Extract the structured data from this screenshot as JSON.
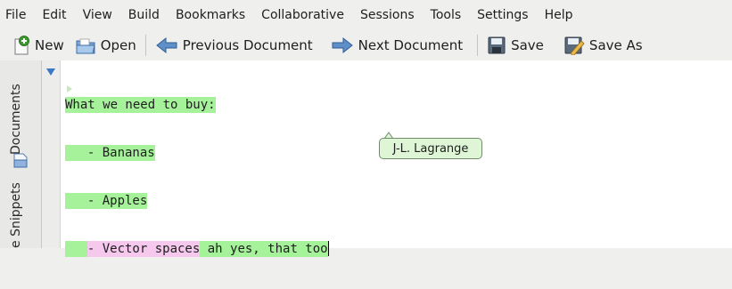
{
  "menu": [
    "File",
    "Edit",
    "View",
    "Build",
    "Bookmarks",
    "Collaborative",
    "Sessions",
    "Tools",
    "Settings",
    "Help"
  ],
  "toolbar": {
    "new_label": "New",
    "open_label": "Open",
    "prev_label": "Previous Document",
    "next_label": "Next Document",
    "save_label": "Save",
    "saveas_label": "Save As"
  },
  "sidepanel": {
    "documents_label": "Documents",
    "snippets_label": "e Snippets"
  },
  "editor": {
    "line1": "What we need to buy:",
    "line2": "  - Bananas",
    "line3": "  - Apples",
    "line4_prefix": "  ",
    "line4_bullet": "- Vector spaces",
    "line4_space": " ",
    "line4_rest": "ah yes, that too"
  },
  "tooltip": {
    "author": "J-L. Lagrange"
  },
  "colors": {
    "collab_green": "#a6f29a",
    "collab_pink": "#f6c8ee",
    "tooltip_bg": "#dff6d6"
  }
}
